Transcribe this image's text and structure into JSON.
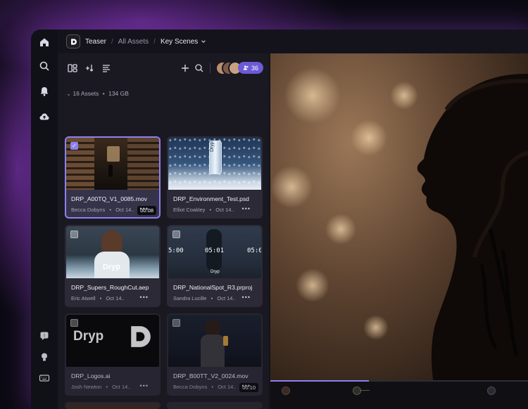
{
  "breadcrumb": {
    "project": "Teaser",
    "level2": "All Assets",
    "current": "Key Scenes"
  },
  "toolbar": {
    "member_count": "36"
  },
  "assets_summary": {
    "count": "16 Assets",
    "size": "134 GB"
  },
  "assets": [
    {
      "name": "DRP_A00TQ_V1_0085.mov",
      "author": "Becca Dobyns",
      "date": "Oct 14..",
      "duration": "00:08",
      "selected": true
    },
    {
      "name": "DRP_Environment_Test.psd",
      "author": "Elliot Coakley",
      "date": "Oct 14..",
      "selected": false
    },
    {
      "name": "DRP_Supers_RoughCut.aep",
      "author": "Eric Atwell",
      "date": "Oct 14..",
      "selected": false
    },
    {
      "name": "DRP_NationalSpot_R3.prproj",
      "author": "Sandra Lucille",
      "date": "Oct 14..",
      "selected": false
    },
    {
      "name": "DRP_Logos.ai",
      "author": "Josh Newton",
      "date": "Oct 14..",
      "selected": false
    },
    {
      "name": "DRP_B00TT_V2_0024.mov",
      "author": "Becca Dobyns",
      "date": "Oct 14..",
      "duration": "00:10",
      "selected": false
    }
  ],
  "thumb_text": {
    "brand": "Dryp",
    "tc1": "5:00",
    "tc2": "05:01",
    "tc3": "05:0"
  },
  "ui": {
    "dot": "•",
    "more": "•••",
    "check": "✓"
  },
  "colors": {
    "accent": "#8e80ef",
    "pill": "#6b5bd6",
    "glow": "#9b3fd8"
  }
}
